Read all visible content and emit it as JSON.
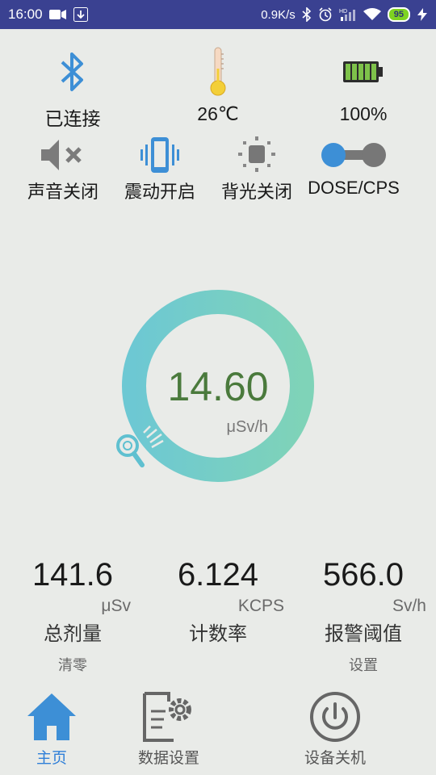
{
  "status_bar": {
    "time": "16:00",
    "net_speed": "0.9K/s",
    "battery": "95",
    "signal_badge": "HD"
  },
  "device_status": {
    "bluetooth": {
      "icon": "bluetooth-icon",
      "label": "已连接"
    },
    "temperature": {
      "icon": "thermometer-icon",
      "label": "26℃"
    },
    "battery": {
      "icon": "battery-icon",
      "label": "100%"
    }
  },
  "toggles": [
    {
      "icon": "speaker-mute-icon",
      "label": "声音关闭"
    },
    {
      "icon": "vibrate-icon",
      "label": "震动开启"
    },
    {
      "icon": "backlight-icon",
      "label": "背光关闭"
    },
    {
      "icon": "toggle-switch-icon",
      "label": "DOSE/CPS"
    }
  ],
  "gauge": {
    "value": "14.60",
    "unit": "μSv/h"
  },
  "metrics": [
    {
      "value": "141.6",
      "unit": "μSv",
      "title": "总剂量",
      "action": "清零"
    },
    {
      "value": "6.124",
      "unit": "KCPS",
      "title": "计数率",
      "action": ""
    },
    {
      "value": "566.0",
      "unit": "Sv/h",
      "title": "报警阈值",
      "action": "设置"
    }
  ],
  "nav": [
    {
      "icon": "home-icon",
      "label": "主页",
      "active": true
    },
    {
      "icon": "data-settings-icon",
      "label": "数据设置",
      "active": false
    },
    {
      "icon": "power-icon",
      "label": "设备关机",
      "active": false
    }
  ],
  "colors": {
    "status_bar": "#3a4191",
    "accent_blue": "#2f7fd8",
    "gauge_teal": "#6fcec7",
    "value_green": "#4a7a3c",
    "background": "#e9ebe8"
  }
}
